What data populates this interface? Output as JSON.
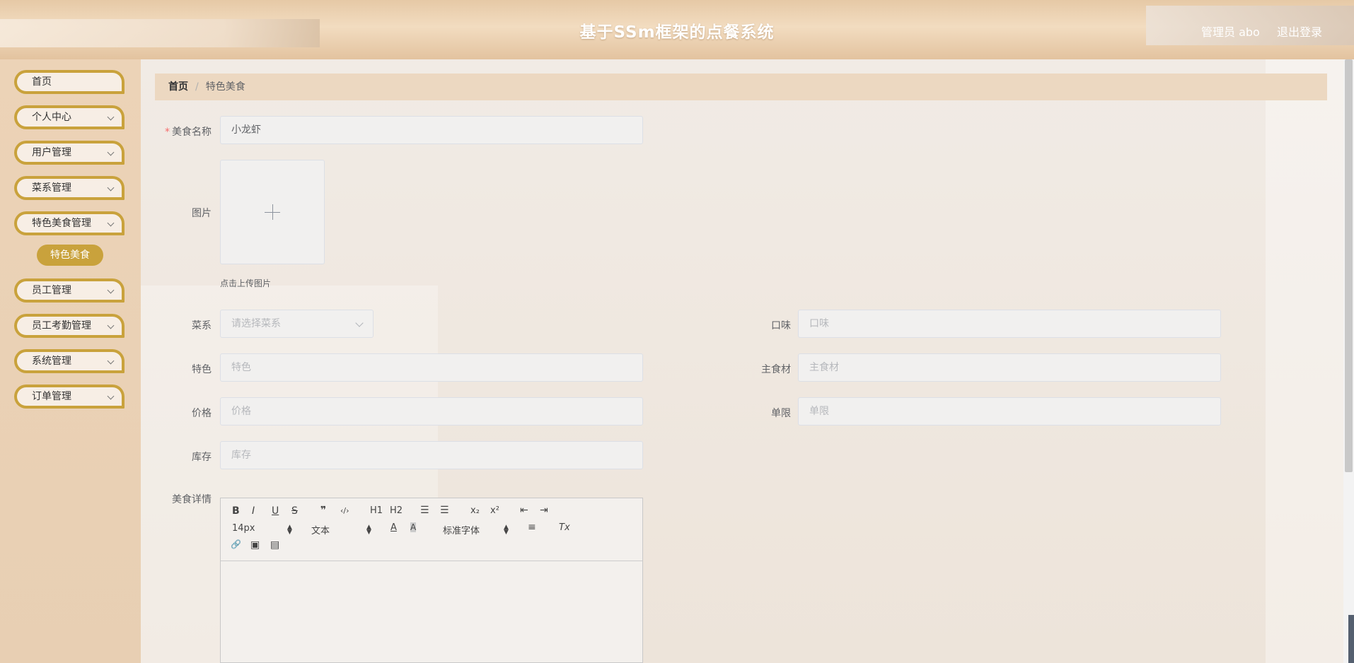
{
  "header": {
    "title": "基于SSm框架的点餐系统",
    "user": "管理员 abo",
    "logout": "退出登录"
  },
  "sidebar": {
    "items": [
      {
        "label": "首页"
      },
      {
        "label": "个人中心"
      },
      {
        "label": "用户管理"
      },
      {
        "label": "菜系管理"
      },
      {
        "label": "特色美食管理"
      },
      {
        "label": "员工管理"
      },
      {
        "label": "员工考勤管理"
      },
      {
        "label": "系统管理"
      },
      {
        "label": "订单管理"
      }
    ],
    "active_sub": "特色美食"
  },
  "breadcrumb": {
    "home": "首页",
    "separator": "/",
    "current": "特色美食"
  },
  "form": {
    "name": {
      "label": "美食名称",
      "value": "小龙虾"
    },
    "image": {
      "label": "图片",
      "tip": "点击上传图片"
    },
    "cuisine": {
      "label": "菜系",
      "placeholder": "请选择菜系"
    },
    "taste": {
      "label": "口味",
      "placeholder": "口味"
    },
    "feature": {
      "label": "特色",
      "placeholder": "特色"
    },
    "main_ingredient": {
      "label": "主食材",
      "placeholder": "主食材"
    },
    "price": {
      "label": "价格",
      "placeholder": "价格"
    },
    "limit": {
      "label": "单限",
      "placeholder": "单限"
    },
    "stock": {
      "label": "库存",
      "placeholder": "库存"
    },
    "detail": {
      "label": "美食详情"
    }
  },
  "editor": {
    "bold": "B",
    "italic": "I",
    "underline": "U",
    "strike": "S",
    "quote": "❞",
    "code": "‹/›",
    "h1": "H1",
    "h2": "H2",
    "ordered": "☰",
    "bullet": "☰",
    "sub": "x₂",
    "sup": "x²",
    "indent_less": "⇤",
    "indent_more": "⇥",
    "size": "14px",
    "format": "文本",
    "font": "标准字体",
    "color": "A",
    "bgcolor": "A",
    "align": "≡",
    "clear": "Tx",
    "link": "🔗",
    "image": "▣",
    "video": "▤"
  },
  "colors": {
    "accent": "#c9a23c",
    "sidebar_bg": "#ecd3b7",
    "header_bg": "#e6c9a6"
  }
}
